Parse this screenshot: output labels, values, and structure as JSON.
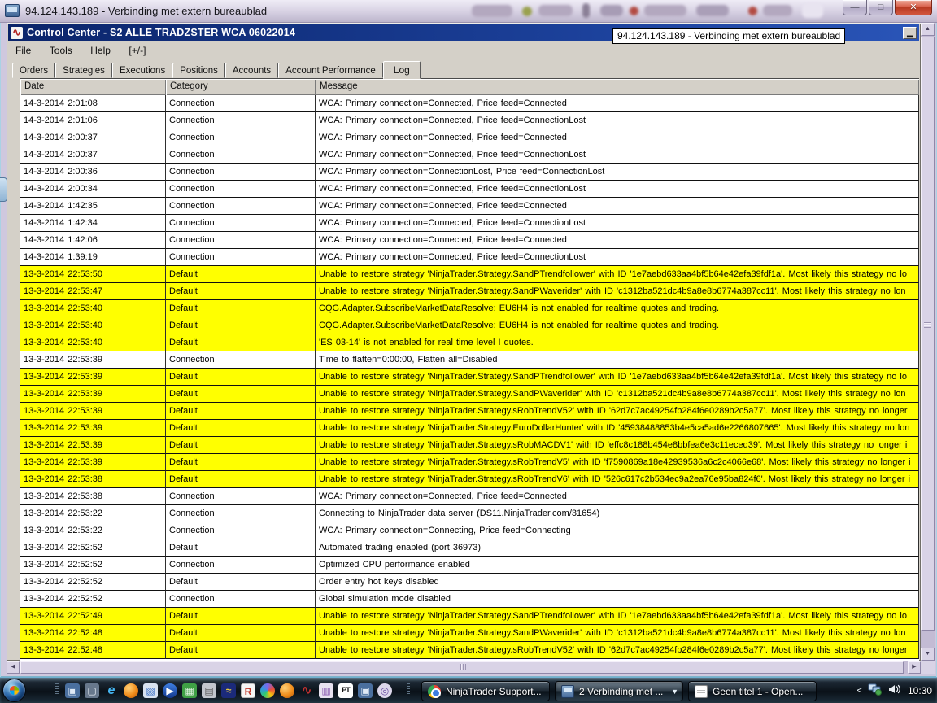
{
  "remote_bar": {
    "title": "94.124.143.189 - Verbinding met extern bureaublad",
    "tooltip": "94.124.143.189 - Verbinding met extern bureaublad",
    "window_buttons": [
      {
        "name": "minimize",
        "glyph": "—"
      },
      {
        "name": "maximize",
        "glyph": "□"
      },
      {
        "name": "close",
        "glyph": "✕"
      }
    ]
  },
  "window": {
    "title": "Control Center - S2 ALLE TRADZSTER WCA 06022014",
    "icon": "ninjatrader-logo",
    "minimize_glyph": "▂",
    "menu": [
      "File",
      "Tools",
      "Help",
      "[+/-]"
    ],
    "tabs": [
      "Orders",
      "Strategies",
      "Executions",
      "Positions",
      "Accounts",
      "Account Performance",
      "Log"
    ],
    "active_tab": "Log"
  },
  "log": {
    "columns": [
      "Date",
      "Category",
      "Message"
    ],
    "rows": [
      {
        "date": "14-3-2014 2:01:08",
        "category": "Connection",
        "message": "WCA:  Primary  connection=Connected,  Price  feed=Connected",
        "highlight": false
      },
      {
        "date": "14-3-2014 2:01:06",
        "category": "Connection",
        "message": "WCA:  Primary  connection=Connected,  Price  feed=ConnectionLost",
        "highlight": false
      },
      {
        "date": "14-3-2014 2:00:37",
        "category": "Connection",
        "message": "WCA:  Primary  connection=Connected,  Price  feed=Connected",
        "highlight": false
      },
      {
        "date": "14-3-2014 2:00:37",
        "category": "Connection",
        "message": "WCA:  Primary  connection=Connected,  Price  feed=ConnectionLost",
        "highlight": false
      },
      {
        "date": "14-3-2014 2:00:36",
        "category": "Connection",
        "message": "WCA:  Primary  connection=ConnectionLost,  Price  feed=ConnectionLost",
        "highlight": false
      },
      {
        "date": "14-3-2014 2:00:34",
        "category": "Connection",
        "message": "WCA:  Primary  connection=Connected,  Price  feed=ConnectionLost",
        "highlight": false
      },
      {
        "date": "14-3-2014 1:42:35",
        "category": "Connection",
        "message": "WCA:  Primary  connection=Connected,  Price  feed=Connected",
        "highlight": false
      },
      {
        "date": "14-3-2014 1:42:34",
        "category": "Connection",
        "message": "WCA:  Primary  connection=Connected,  Price  feed=ConnectionLost",
        "highlight": false
      },
      {
        "date": "14-3-2014 1:42:06",
        "category": "Connection",
        "message": "WCA:  Primary  connection=Connected,  Price  feed=Connected",
        "highlight": false
      },
      {
        "date": "14-3-2014 1:39:19",
        "category": "Connection",
        "message": "WCA:  Primary  connection=Connected,  Price  feed=ConnectionLost",
        "highlight": false
      },
      {
        "date": "13-3-2014 22:53:50",
        "category": "Default",
        "message": "Unable to restore strategy 'NinjaTrader.Strategy.SandPTrendfollower' with ID '1e7aebd633aa4bf5b64e42efa39fdf1a'. Most likely this strategy no lo",
        "highlight": true
      },
      {
        "date": "13-3-2014 22:53:47",
        "category": "Default",
        "message": "Unable to restore strategy 'NinjaTrader.Strategy.SandPWaverider' with ID 'c1312ba521dc4b9a8e8b6774a387cc11'. Most likely this strategy no lon",
        "highlight": true
      },
      {
        "date": "13-3-2014 22:53:40",
        "category": "Default",
        "message": "CQG.Adapter.SubscribeMarketDataResolve: EU6H4 is not enabled for realtime quotes and trading.",
        "highlight": true
      },
      {
        "date": "13-3-2014 22:53:40",
        "category": "Default",
        "message": "CQG.Adapter.SubscribeMarketDataResolve: EU6H4 is not enabled for realtime quotes and trading.",
        "highlight": true
      },
      {
        "date": "13-3-2014 22:53:40",
        "category": "Default",
        "message": "'ES 03-14' is not enabled for real time level I quotes.",
        "highlight": true
      },
      {
        "date": "13-3-2014 22:53:39",
        "category": "Connection",
        "message": "Time to flatten=0:00:00, Flatten all=Disabled",
        "highlight": false
      },
      {
        "date": "13-3-2014 22:53:39",
        "category": "Default",
        "message": "Unable to restore strategy 'NinjaTrader.Strategy.SandPTrendfollower' with ID '1e7aebd633aa4bf5b64e42efa39fdf1a'. Most likely this strategy no lo",
        "highlight": true
      },
      {
        "date": "13-3-2014 22:53:39",
        "category": "Default",
        "message": "Unable to restore strategy 'NinjaTrader.Strategy.SandPWaverider' with ID 'c1312ba521dc4b9a8e8b6774a387cc11'. Most likely this strategy no lon",
        "highlight": true
      },
      {
        "date": "13-3-2014 22:53:39",
        "category": "Default",
        "message": "Unable to restore strategy 'NinjaTrader.Strategy.sRobTrendV52' with ID '62d7c7ac49254fb284f6e0289b2c5a77'. Most likely this strategy no longer",
        "highlight": true
      },
      {
        "date": "13-3-2014 22:53:39",
        "category": "Default",
        "message": "Unable to restore strategy 'NinjaTrader.Strategy.EuroDollarHunter' with ID '45938488853b4e5ca5ad6e2266807665'. Most likely this strategy no lon",
        "highlight": true
      },
      {
        "date": "13-3-2014 22:53:39",
        "category": "Default",
        "message": "Unable to restore strategy 'NinjaTrader.Strategy.sRobMACDV1' with ID 'effc8c188b454e8bbfea6e3c11eced39'. Most likely this strategy no longer i",
        "highlight": true
      },
      {
        "date": "13-3-2014 22:53:39",
        "category": "Default",
        "message": "Unable to restore strategy 'NinjaTrader.Strategy.sRobTrendV5' with ID 'f7590869a18e42939536a6c2c4066e68'. Most likely this strategy no longer i",
        "highlight": true
      },
      {
        "date": "13-3-2014 22:53:38",
        "category": "Default",
        "message": "Unable to restore strategy 'NinjaTrader.Strategy.sRobTrendV6' with ID '526c617c2b534ec9a2ea76e95ba824f6'. Most likely this strategy no longer i",
        "highlight": true
      },
      {
        "date": "13-3-2014 22:53:38",
        "category": "Connection",
        "message": "WCA:  Primary  connection=Connected,  Price  feed=Connected",
        "highlight": false
      },
      {
        "date": "13-3-2014 22:53:22",
        "category": "Connection",
        "message": "Connecting to NinjaTrader data server (DS11.NinjaTrader.com/31654)",
        "highlight": false
      },
      {
        "date": "13-3-2014 22:53:22",
        "category": "Connection",
        "message": "WCA:  Primary  connection=Connecting,  Price  feed=Connecting",
        "highlight": false
      },
      {
        "date": "13-3-2014 22:52:52",
        "category": "Default",
        "message": "Automated trading enabled (port 36973)",
        "highlight": false
      },
      {
        "date": "13-3-2014 22:52:52",
        "category": "Connection",
        "message": "Optimized CPU performance enabled",
        "highlight": false
      },
      {
        "date": "13-3-2014 22:52:52",
        "category": "Default",
        "message": "Order entry hot keys disabled",
        "highlight": false
      },
      {
        "date": "13-3-2014 22:52:52",
        "category": "Connection",
        "message": "Global simulation mode disabled",
        "highlight": false
      },
      {
        "date": "13-3-2014 22:52:49",
        "category": "Default",
        "message": "Unable to restore strategy 'NinjaTrader.Strategy.SandPTrendfollower' with ID '1e7aebd633aa4bf5b64e42efa39fdf1a'. Most likely this strategy no lo",
        "highlight": true
      },
      {
        "date": "13-3-2014 22:52:48",
        "category": "Default",
        "message": "Unable to restore strategy 'NinjaTrader.Strategy.SandPWaverider' with ID 'c1312ba521dc4b9a8e8b6774a387cc11'. Most likely this strategy no lon",
        "highlight": true
      },
      {
        "date": "13-3-2014 22:52:48",
        "category": "Default",
        "message": "Unable to restore strategy 'NinjaTrader.Strategy.sRobTrendV52' with ID '62d7c7ac49254fb284f6e0289b2c5a77'. Most likely this strategy no longer",
        "highlight": true
      }
    ]
  },
  "scrollbars": {
    "up_glyph": "▲",
    "down_glyph": "▼",
    "left_glyph": "◀",
    "right_glyph": "▶"
  },
  "taskbar": {
    "quicklaunch": [
      {
        "name": "remote-desktop",
        "glyph": "▣",
        "bg": "#4a6f9e",
        "fg": "#dfe9f5"
      },
      {
        "name": "show-desktop",
        "glyph": "▢",
        "bg": "#68788c",
        "fg": "#e8eef5"
      },
      {
        "name": "internet-explorer",
        "glyph": "e",
        "bg": "transparent",
        "fg": "#45b6f2"
      },
      {
        "name": "chrome",
        "glyph": "",
        "bg": "radial-gradient(circle at 35% 30%, #ffd27a, #f08c1a 55%, #b35409)",
        "fg": "#fff",
        "round": true
      },
      {
        "name": "explorer",
        "glyph": "▧",
        "bg": "#d8e2f0",
        "fg": "#3a6fc4"
      },
      {
        "name": "media-player",
        "glyph": "▶",
        "bg": "linear-gradient(#3d7de0,#14388c)",
        "fg": "#fff",
        "round": true
      },
      {
        "name": "vmware",
        "glyph": "▦",
        "bg": "#3fa045",
        "fg": "#e8f5e8"
      },
      {
        "name": "fax-printer",
        "glyph": "▤",
        "bg": "#c2c6ce",
        "fg": "#555555"
      },
      {
        "name": "trading-app",
        "glyph": "≈",
        "bg": "#1b2a7a",
        "fg": "#f0d040"
      },
      {
        "name": "r-project",
        "glyph": "R",
        "bg": "#f5f5f5",
        "fg": "#c0392b"
      },
      {
        "name": "picasa",
        "glyph": "",
        "bg": "conic-gradient(#7b68ee,#e74c3c,#f1c40f,#2ecc71,#3498db,#7b68ee)",
        "fg": "#fff",
        "round": true
      },
      {
        "name": "chrome-ball",
        "glyph": "",
        "bg": "radial-gradient(circle at 35% 30%, #ffd27a, #f08c1a 55%, #b35409)",
        "fg": "#fff",
        "round": true
      },
      {
        "name": "ninjatrader",
        "glyph": "∿",
        "bg": "transparent",
        "fg": "#c03030"
      },
      {
        "name": "winrar",
        "glyph": "▥",
        "bg": "#e8e2f0",
        "fg": "#8a5ab0"
      },
      {
        "name": "pt-tool",
        "glyph": "PT",
        "bg": "#ffffff",
        "fg": "#111111"
      },
      {
        "name": "remote-desktop-2",
        "glyph": "▣",
        "bg": "#4a6f9e",
        "fg": "#dfe9f5"
      },
      {
        "name": "utorrent",
        "glyph": "◎",
        "bg": "#ddd8ec",
        "fg": "#6a4fa0",
        "round": true
      }
    ],
    "buttons": [
      {
        "label": "NinjaTrader Support...",
        "icon": "chrome-ball",
        "active": false
      },
      {
        "label": "2 Verbinding met ...",
        "icon": "remote-desktop",
        "active": true,
        "dropdown_glyph": "▼"
      },
      {
        "label": "Geen titel 1 - Open...",
        "icon": "writer-document",
        "active": false
      }
    ],
    "tray": {
      "collapse_glyph": "<",
      "clock": "10:30"
    }
  },
  "colors": {
    "highlight_row": "#ffff00",
    "titlebar_navy": "#0a246a",
    "chrome_grey": "#d4d0c8",
    "rdp_lavender": "#cfc8de",
    "taskbar_accent": "#6fb0d0"
  }
}
